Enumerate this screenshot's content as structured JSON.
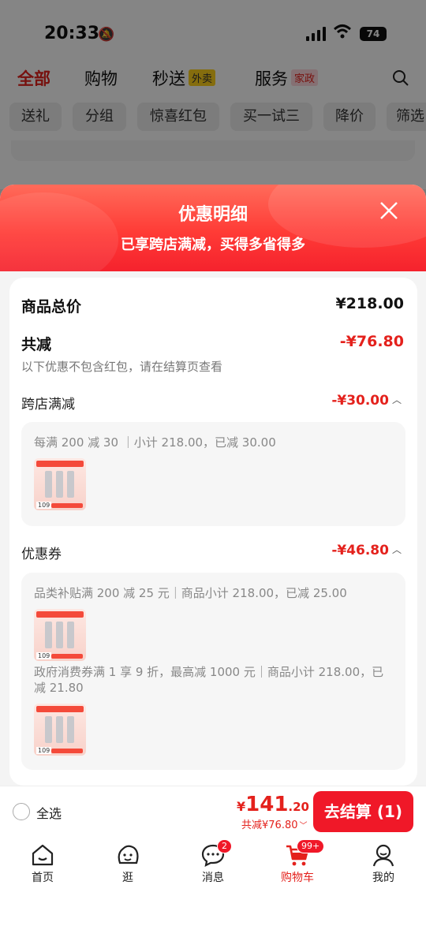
{
  "status": {
    "time": "20:33",
    "battery": "74"
  },
  "top_nav": {
    "tabs": [
      {
        "label": "全部",
        "active": true
      },
      {
        "label": "购物"
      },
      {
        "label": "秒送",
        "tag": "外卖"
      },
      {
        "label": "服务",
        "tag": "家政"
      }
    ]
  },
  "chips": [
    "送礼",
    "分组",
    "惊喜红包",
    "买一试三",
    "降价",
    "筛选"
  ],
  "sheet": {
    "title": "优惠明细",
    "subtitle": "已享跨店满减，买得多省得多",
    "total_label": "商品总价",
    "total_value": "¥218.00",
    "discount_label": "共减",
    "discount_value": "-¥76.80",
    "note": "以下优惠不包含红包，请在结算页查看",
    "sections": [
      {
        "label": "跨店满减",
        "value": "-¥30.00",
        "lines": [
          "每满 200 减 30 ｜小计 218.00，已减 30.00"
        ]
      },
      {
        "label": "优惠券",
        "value": "-¥46.80",
        "lines": [
          "品类补贴满 200 减 25 元｜商品小计 218.00，已减 25.00",
          "政府消费券满 1 享 9 折，最高减 1000 元｜商品小计 218.00，已减 21.80"
        ]
      }
    ],
    "thumb_price": "109"
  },
  "checkout": {
    "select_all": "全选",
    "currency": "¥",
    "price_int": "141",
    "price_dec": ".20",
    "saved": "共减¥76.80",
    "pay_label": "去结算 (1)"
  },
  "tabbar": [
    {
      "label": "首页",
      "icon": "home-icon"
    },
    {
      "label": "逛",
      "icon": "smile-face-icon"
    },
    {
      "label": "消息",
      "icon": "chat-bubble-icon",
      "badge": "2"
    },
    {
      "label": "购物车",
      "icon": "cart-icon",
      "badge": "99+",
      "active": true
    },
    {
      "label": "我的",
      "icon": "person-icon"
    }
  ]
}
